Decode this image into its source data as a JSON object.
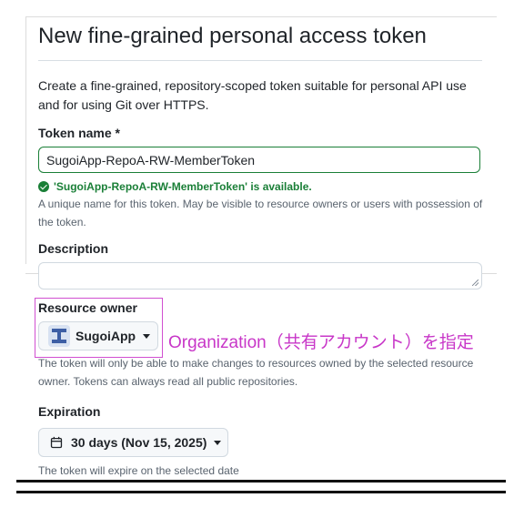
{
  "page": {
    "title": "New fine-grained personal access token",
    "intro": "Create a fine-grained, repository-scoped token suitable for personal API use and for using Git over HTTPS."
  },
  "token_name": {
    "label": "Token name *",
    "value": "SugoiApp-RepoA-RW-MemberToken",
    "validation": "'SugoiApp-RepoA-RW-MemberToken' is available.",
    "hint": "A unique name for this token. May be visible to resource owners or users with possession of the token."
  },
  "description": {
    "label": "Description",
    "value": ""
  },
  "resource_owner": {
    "label": "Resource owner",
    "selected": "SugoiApp",
    "hint": "The token will only be able to make changes to resources owned by the selected resource owner. Tokens can always read all public repositories."
  },
  "annotation": {
    "text": "Organization（共有アカウント）を指定",
    "color": "#c837c8"
  },
  "expiration": {
    "label": "Expiration",
    "selected": "30 days (Nov 15, 2025)",
    "hint": "The token will expire on the selected date"
  },
  "colors": {
    "success": "#1a7f37",
    "muted": "#59636e",
    "border": "#d1d9e0"
  },
  "icons": [
    "check-circle-icon",
    "organization-avatar-icon",
    "caret-down-icon",
    "calendar-icon",
    "resize-grip-icon"
  ]
}
